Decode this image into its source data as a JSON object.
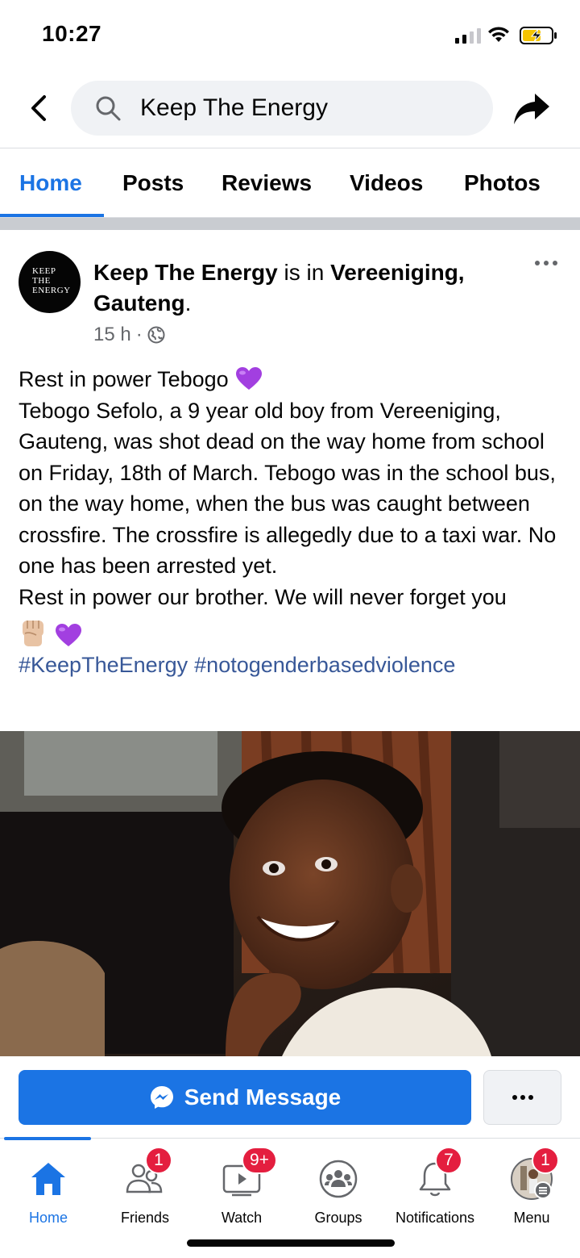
{
  "status_bar": {
    "time": "10:27"
  },
  "search": {
    "query": "Keep The Energy"
  },
  "tabs": [
    {
      "label": "Home",
      "active": true
    },
    {
      "label": "Posts",
      "active": false
    },
    {
      "label": "Reviews",
      "active": false
    },
    {
      "label": "Videos",
      "active": false
    },
    {
      "label": "Photos",
      "active": false
    }
  ],
  "post": {
    "avatar_text": [
      "KEEP",
      "THE",
      "ENERGY"
    ],
    "author": "Keep The Energy",
    "is_in": " is in ",
    "location": "Vereeniging, Gauteng",
    "location_end": ".",
    "time": "15 h",
    "separator": "·",
    "privacy_icon": "globe-icon",
    "body_line1": "Rest in power Tebogo",
    "body_para": "Tebogo Sefolo, a 9 year old boy from Vereeniging, Gauteng, was shot dead on the way home from school on Friday, 18th of March. Tebogo was in the school bus, on the way home, when the bus was caught between crossfire. The crossfire is allegedly due to a taxi war. No one has been arrested yet.",
    "body_last": "Rest in power our brother. We will never forget you",
    "emojis": [
      "raised-fist",
      "purple-heart"
    ],
    "hashtags": [
      "#KeepTheEnergy",
      "#notogenderbasedviolence"
    ]
  },
  "cta": {
    "send_message": "Send Message"
  },
  "bottom_nav": [
    {
      "label": "Home",
      "icon": "home-icon",
      "badge": null,
      "active": true
    },
    {
      "label": "Friends",
      "icon": "friends-icon",
      "badge": "1",
      "active": false
    },
    {
      "label": "Watch",
      "icon": "watch-icon",
      "badge": "9+",
      "active": false
    },
    {
      "label": "Groups",
      "icon": "groups-icon",
      "badge": null,
      "active": false
    },
    {
      "label": "Notifications",
      "icon": "bell-icon",
      "badge": "7",
      "active": false
    },
    {
      "label": "Menu",
      "icon": "menu-avatar-icon",
      "badge": "1",
      "active": false
    }
  ],
  "colors": {
    "accent": "#1b74e4",
    "badge": "#e41e3f",
    "hashtag": "#385898",
    "secondary_text": "#65676b"
  }
}
